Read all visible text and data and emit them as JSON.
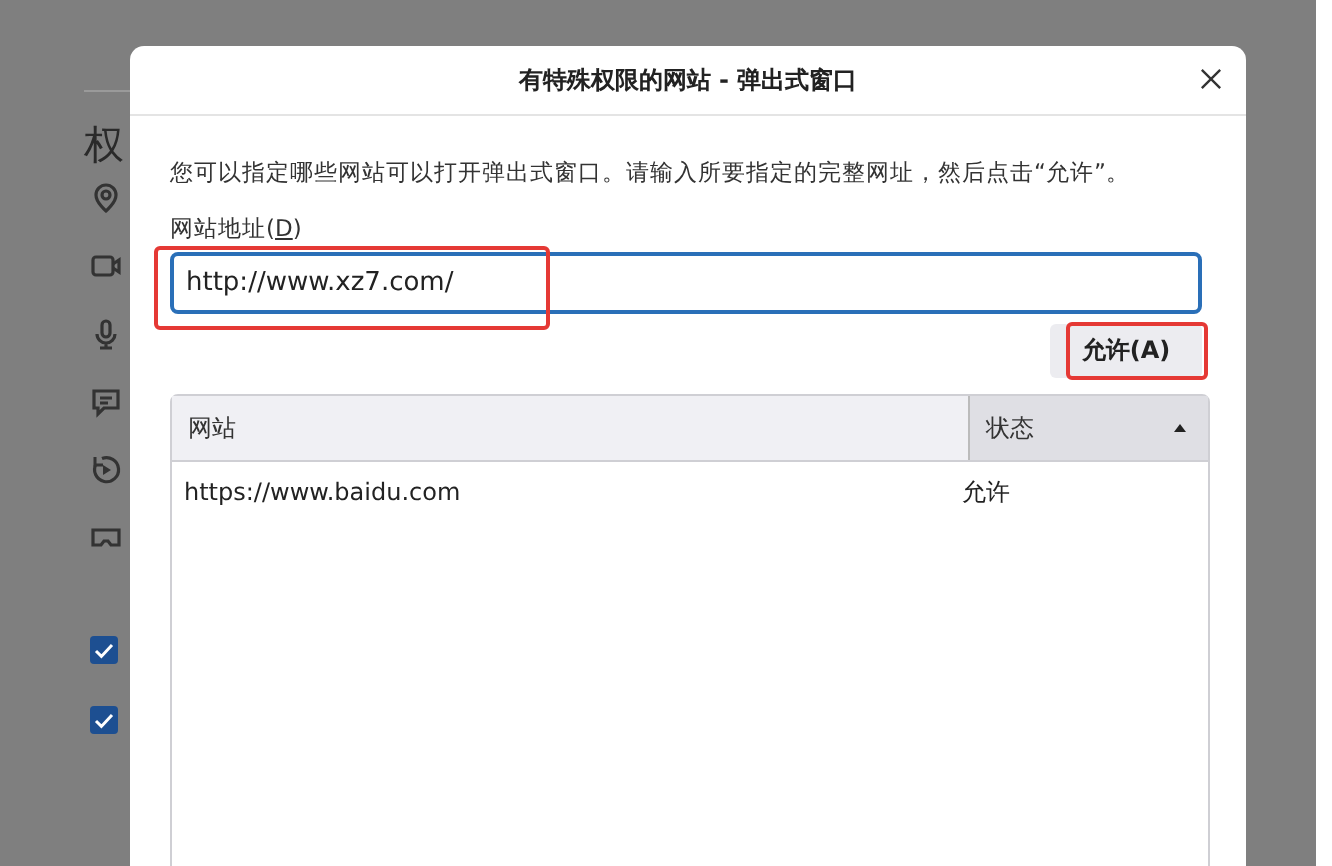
{
  "background_page": {
    "heading": "权",
    "checkboxes": [
      {
        "checked": true
      },
      {
        "checked": true
      }
    ]
  },
  "dialog": {
    "title": "有特殊权限的网站 - 弹出式窗口",
    "description": "您可以指定哪些网站可以打开弹出式窗口。请输入所要指定的完整网址，然后点击“允许”。",
    "address_label": {
      "before": "网站地址(",
      "access_key": "D",
      "after": ")"
    },
    "address_field": {
      "value": "http://www.xz7.com/",
      "highlighted": true
    },
    "allow_button": {
      "label": "允许(A)",
      "highlighted": true
    },
    "table": {
      "columns": [
        {
          "label": "网站",
          "sorted": false
        },
        {
          "label": "状态",
          "sorted": true
        }
      ],
      "rows": [
        {
          "cells": [
            "https://www.baidu.com",
            "允许"
          ]
        }
      ]
    }
  }
}
